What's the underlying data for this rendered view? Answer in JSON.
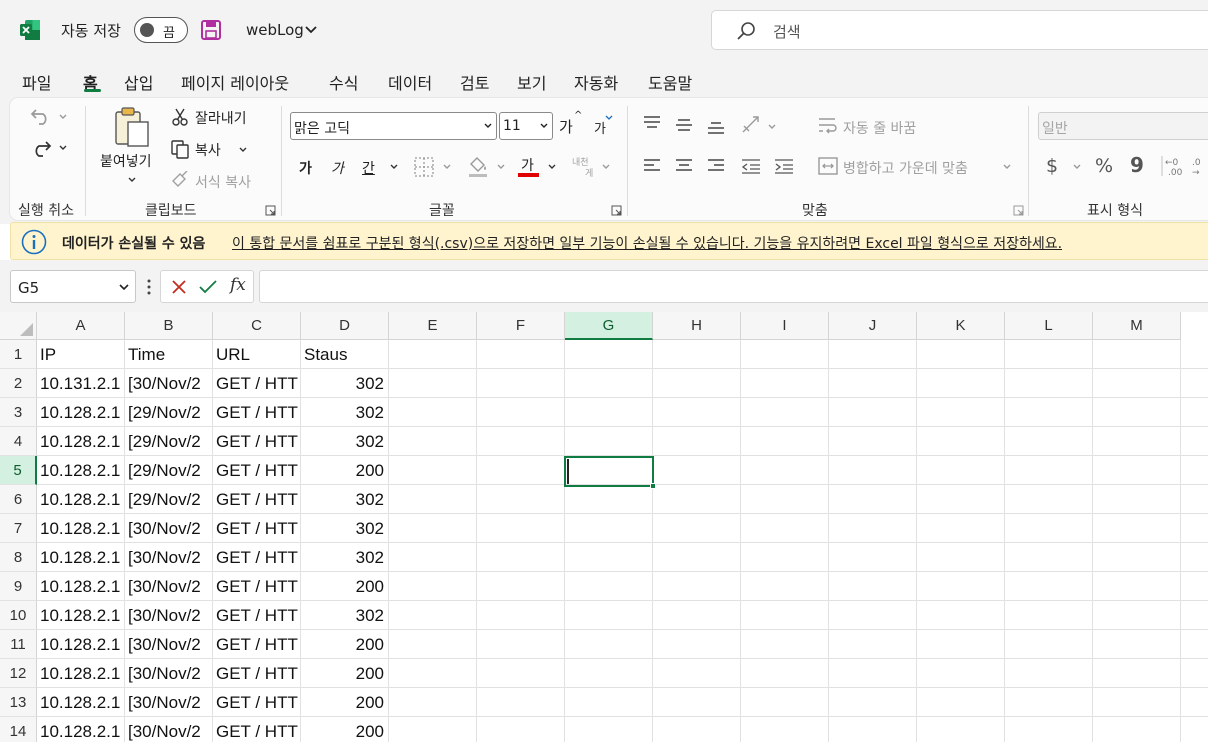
{
  "app": {
    "autosave_label": "자동 저장",
    "autosave_state": "끔",
    "filename": "webLog",
    "search_placeholder": "검색",
    "accent_color": "#107c41"
  },
  "menu_tabs": [
    "파일",
    "홈",
    "삽입",
    "페이지 레이아웃",
    "수식",
    "데이터",
    "검토",
    "보기",
    "자동화",
    "도움말"
  ],
  "active_tab": "홈",
  "ribbon": {
    "undo_group_label": "실행 취소",
    "clipboard": {
      "group_label": "클립보드",
      "paste": "붙여넣기",
      "cut": "잘라내기",
      "copy": "복사",
      "format_painter": "서식 복사"
    },
    "font": {
      "group_label": "글꼴",
      "font_name": "맑은 고딕",
      "font_size": "11",
      "grow": "가",
      "shrink": "가",
      "bold": "가",
      "italic": "가",
      "underline": "간",
      "font_color": "가",
      "phonetic_line1": "내천",
      "phonetic_line2": "게"
    },
    "alignment": {
      "group_label": "맞춤",
      "wrap_text": "자동 줄 바꿈",
      "merge_center": "병합하고 가운데 맞춤"
    },
    "number": {
      "group_label": "표시 형식",
      "format": "일반",
      "currency": "$",
      "percent": "%",
      "comma": "9"
    }
  },
  "infobar": {
    "title": "데이터가 손실될 수 있음",
    "message": "이 통합 문서를 쉼표로 구분된 형식(.csv)으로 저장하면 일부 기능이 손실될 수 있습니다. 기능을 유지하려면 Excel 파일 형식으로 저장하세요."
  },
  "formula_bar": {
    "name_box": "G5",
    "fx": "fx",
    "content": ""
  },
  "sheet": {
    "columns": [
      "A",
      "B",
      "C",
      "D",
      "E",
      "F",
      "G",
      "H",
      "I",
      "J",
      "K",
      "L",
      "M"
    ],
    "selected_column": "G",
    "selected_row": 5,
    "row_numbers": [
      "1",
      "2",
      "3",
      "4",
      "5",
      "6",
      "7",
      "8",
      "9",
      "10",
      "11",
      "12",
      "13",
      "14"
    ],
    "header_row": [
      "IP",
      "Time",
      "URL",
      "Staus"
    ],
    "rows": [
      [
        "10.131.2.1",
        "[30/Nov/2",
        "GET / HTT",
        "302"
      ],
      [
        "10.128.2.1",
        "[29/Nov/2",
        "GET / HTT",
        "302"
      ],
      [
        "10.128.2.1",
        "[29/Nov/2",
        "GET / HTT",
        "302"
      ],
      [
        "10.128.2.1",
        "[29/Nov/2",
        "GET / HTT",
        "200"
      ],
      [
        "10.128.2.1",
        "[29/Nov/2",
        "GET / HTT",
        "302"
      ],
      [
        "10.128.2.1",
        "[30/Nov/2",
        "GET / HTT",
        "302"
      ],
      [
        "10.128.2.1",
        "[30/Nov/2",
        "GET / HTT",
        "302"
      ],
      [
        "10.128.2.1",
        "[30/Nov/2",
        "GET / HTT",
        "200"
      ],
      [
        "10.128.2.1",
        "[30/Nov/2",
        "GET / HTT",
        "302"
      ],
      [
        "10.128.2.1",
        "[30/Nov/2",
        "GET / HTT",
        "200"
      ],
      [
        "10.128.2.1",
        "[30/Nov/2",
        "GET / HTT",
        "200"
      ],
      [
        "10.128.2.1",
        "[30/Nov/2",
        "GET / HTT",
        "200"
      ],
      [
        "10.128.2.1",
        "[30/Nov/2",
        "GET / HTT",
        "200"
      ]
    ]
  }
}
